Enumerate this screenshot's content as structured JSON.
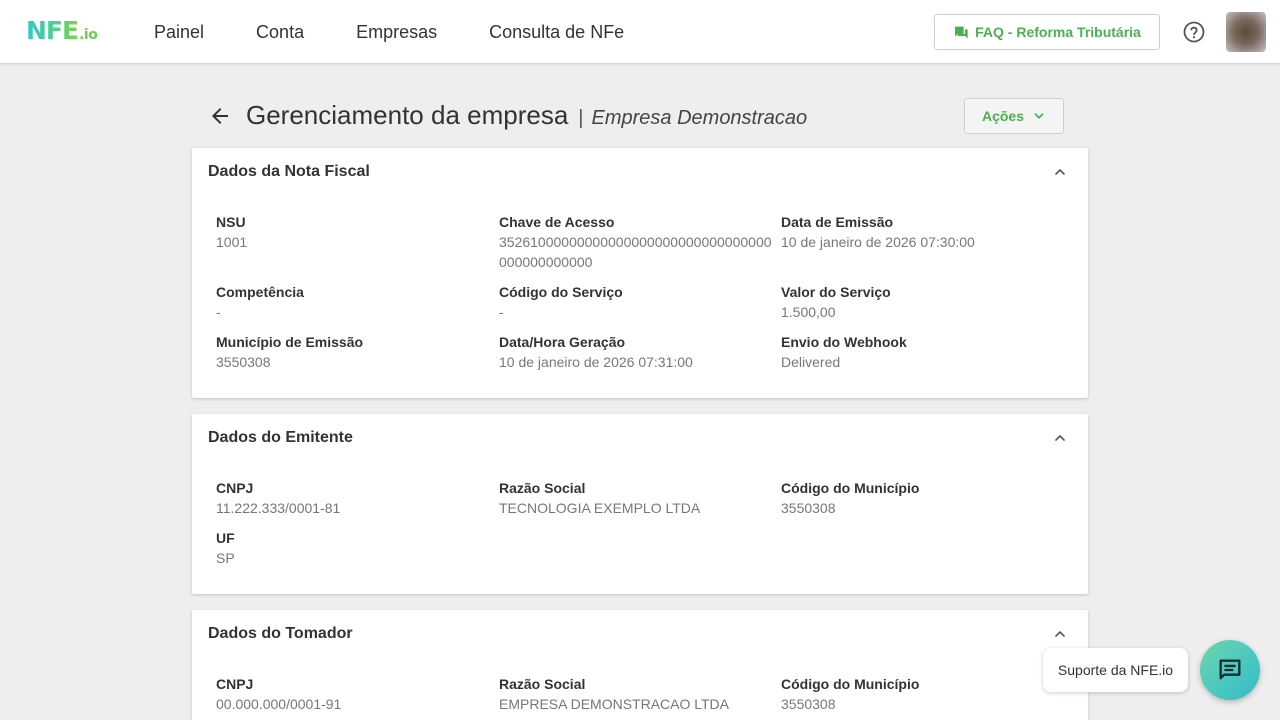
{
  "topbar": {
    "logo_main": "NFE",
    "logo_sub": ".io",
    "nav": [
      "Painel",
      "Conta",
      "Empresas",
      "Consulta de NFe"
    ],
    "faq_label": "FAQ - Reforma Tributária"
  },
  "header": {
    "title": "Gerenciamento da empresa",
    "separator": "|",
    "company": "Empresa Demonstracao",
    "actions_label": "Ações"
  },
  "cards": {
    "nota": {
      "title": "Dados da Nota Fiscal",
      "fields": [
        {
          "label": "NSU",
          "value": "1001"
        },
        {
          "label": "Chave de Acesso",
          "value": "35261000000000000000000000000000000000000000000"
        },
        {
          "label": "Data de Emissão",
          "value": "10 de janeiro de 2026 07:30:00"
        },
        {
          "label": "Competência",
          "value": "-"
        },
        {
          "label": "Código do Serviço",
          "value": "-"
        },
        {
          "label": "Valor do Serviço",
          "value": "1.500,00"
        },
        {
          "label": "Município de Emissão",
          "value": "3550308"
        },
        {
          "label": "Data/Hora Geração",
          "value": "10 de janeiro de 2026 07:31:00"
        },
        {
          "label": "Envio do Webhook",
          "value": "Delivered"
        }
      ]
    },
    "emitente": {
      "title": "Dados do Emitente",
      "fields": [
        {
          "label": "CNPJ",
          "value": "11.222.333/0001-81"
        },
        {
          "label": "Razão Social",
          "value": "TECNOLOGIA EXEMPLO LTDA"
        },
        {
          "label": "Código do Município",
          "value": "3550308"
        },
        {
          "label": "UF",
          "value": "SP"
        }
      ]
    },
    "tomador": {
      "title": "Dados do Tomador",
      "fields": [
        {
          "label": "CNPJ",
          "value": "00.000.000/0001-91"
        },
        {
          "label": "Razão Social",
          "value": "EMPRESA DEMONSTRACAO LTDA"
        },
        {
          "label": "Código do Município",
          "value": "3550308"
        }
      ]
    }
  },
  "support": {
    "label": "Suporte da NFE.io"
  },
  "colors": {
    "accent": "#4caf50",
    "background": "#eeeeee"
  }
}
